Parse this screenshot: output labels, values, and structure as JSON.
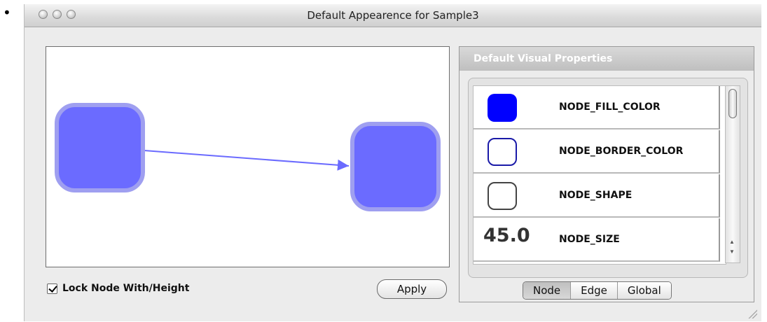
{
  "bullet": "•",
  "window": {
    "title": "Default Appearence for Sample3"
  },
  "preview": {
    "node_fill": "#6b6bff",
    "node_border": "#9f9ff0",
    "edge_color": "#6b6bff"
  },
  "lock": {
    "label": "Lock Node With/Height",
    "checked": true
  },
  "apply_label": "Apply",
  "props": {
    "header": "Default Visual Properties",
    "items": [
      {
        "label": "NODE_FILL_COLOR",
        "icon": "fill-swatch",
        "color": "#0000ff"
      },
      {
        "label": "NODE_BORDER_COLOR",
        "icon": "border-swatch",
        "color": "#1a1aa8"
      },
      {
        "label": "NODE_SHAPE",
        "icon": "shape-swatch",
        "color": "#444444"
      },
      {
        "label": "NODE_SIZE",
        "value": "45.0"
      }
    ]
  },
  "tabs": [
    {
      "label": "Node",
      "active": true
    },
    {
      "label": "Edge",
      "active": false
    },
    {
      "label": "Global",
      "active": false
    }
  ]
}
